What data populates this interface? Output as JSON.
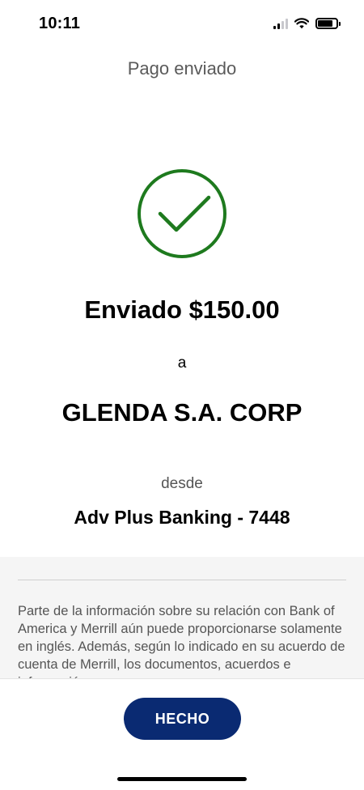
{
  "status_bar": {
    "time": "10:11",
    "signal_bars": 2,
    "battery_level": 0.8
  },
  "header": {
    "title": "Pago enviado"
  },
  "confirmation": {
    "success_icon": "checkmark-circle-icon",
    "success_color": "#1e7a1e",
    "sent_text": "Enviado $150.00",
    "to_label": "a",
    "payee": "GLENDA S.A. CORP",
    "from_label": "desde",
    "account": "Adv Plus Banking - 7448"
  },
  "disclosure": {
    "text": "Parte de la información sobre su relación con Bank of America y Merrill aún puede proporcionarse solamente en inglés. Además, según lo indicado en su acuerdo de cuenta de Merrill, los documentos, acuerdos e información"
  },
  "footer": {
    "done_label": "HECHO",
    "button_color": "#0a2a72"
  }
}
